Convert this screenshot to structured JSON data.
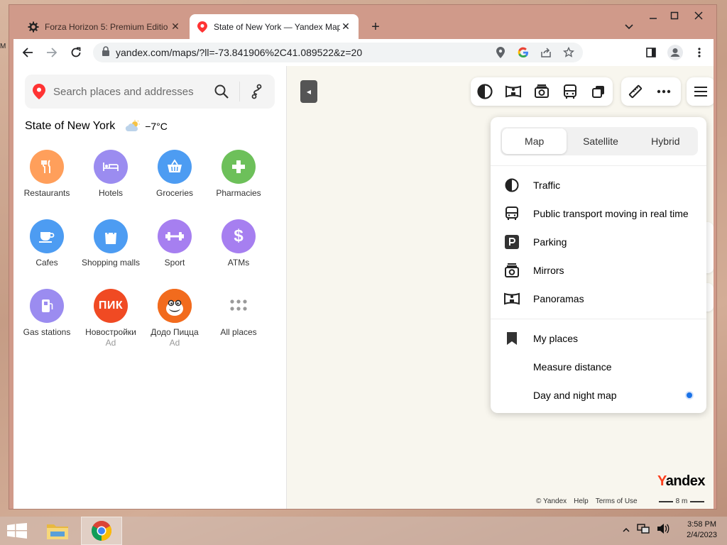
{
  "browser": {
    "tabs": [
      {
        "title": "Forza Horizon 5: Premium Editio",
        "active": false,
        "favicon": "steam-gear-icon"
      },
      {
        "title": "State of New York — Yandex Map",
        "active": true,
        "favicon": "yandex-maps-pin-icon"
      }
    ],
    "new_tab_label": "+",
    "url": "yandex.com/maps/?ll=-73.841906%2C41.089522&z=20"
  },
  "panel": {
    "search_placeholder": "Search places and addresses",
    "region_name": "State of New York",
    "temperature": "−7°C",
    "categories": [
      {
        "label": "Restaurants",
        "color": "#ff9f5b",
        "icon": "fork-knife-icon",
        "ad": ""
      },
      {
        "label": "Hotels",
        "color": "#9b8cf0",
        "icon": "bed-icon",
        "ad": ""
      },
      {
        "label": "Groceries",
        "color": "#4d9cf2",
        "icon": "basket-icon",
        "ad": ""
      },
      {
        "label": "Pharmacies",
        "color": "#6dc05a",
        "icon": "cross-icon",
        "ad": ""
      },
      {
        "label": "Cafes",
        "color": "#4d9cf2",
        "icon": "cup-icon",
        "ad": ""
      },
      {
        "label": "Shopping malls",
        "color": "#4d9cf2",
        "icon": "bag-icon",
        "ad": ""
      },
      {
        "label": "Sport",
        "color": "#a67ff0",
        "icon": "dumbbell-icon",
        "ad": ""
      },
      {
        "label": "ATMs",
        "color": "#a67ff0",
        "icon": "dollar-icon",
        "ad": ""
      },
      {
        "label": "Gas stations",
        "color": "#9b8cf0",
        "icon": "fuel-icon",
        "ad": ""
      },
      {
        "label": "Новостройки",
        "color": "#f04a23",
        "icon": "pik-logo",
        "logo_text": "ПИК",
        "ad": "Ad"
      },
      {
        "label": "Додо Пицца",
        "color": "#f26b1d",
        "icon": "dodo-logo",
        "ad": "Ad"
      },
      {
        "label": "All places",
        "color": "#ffffff",
        "icon": "grid-dots-icon",
        "ad": ""
      }
    ]
  },
  "layers": {
    "modes": [
      "Map",
      "Satellite",
      "Hybrid"
    ],
    "selected_mode": "Map",
    "items": [
      {
        "label": "Traffic",
        "icon": "traffic-icon"
      },
      {
        "label": "Public transport moving in real time",
        "icon": "bus-icon"
      },
      {
        "label": "Parking",
        "icon": "parking-icon"
      },
      {
        "label": "Mirrors",
        "icon": "camera-icon"
      },
      {
        "label": "Panoramas",
        "icon": "panorama-icon"
      }
    ],
    "extra_items": [
      {
        "label": "My places",
        "icon": "bookmark-icon"
      },
      {
        "label": "Measure distance",
        "icon": ""
      },
      {
        "label": "Day and night map",
        "icon": ""
      }
    ]
  },
  "map": {
    "brand": "Yandex",
    "brand_y": "Y",
    "brand_rest": "andex",
    "footer_copyright": "© Yandex",
    "footer_help": "Help",
    "footer_terms": "Terms of Use",
    "scale_label": "8 m"
  },
  "desktop": {
    "edge_text": "M"
  },
  "taskbar": {
    "time": "3:58 PM",
    "date": "2/4/2023"
  },
  "colors": {
    "accent": "#1a73e8",
    "yandex_red": "#fc3f1d"
  }
}
